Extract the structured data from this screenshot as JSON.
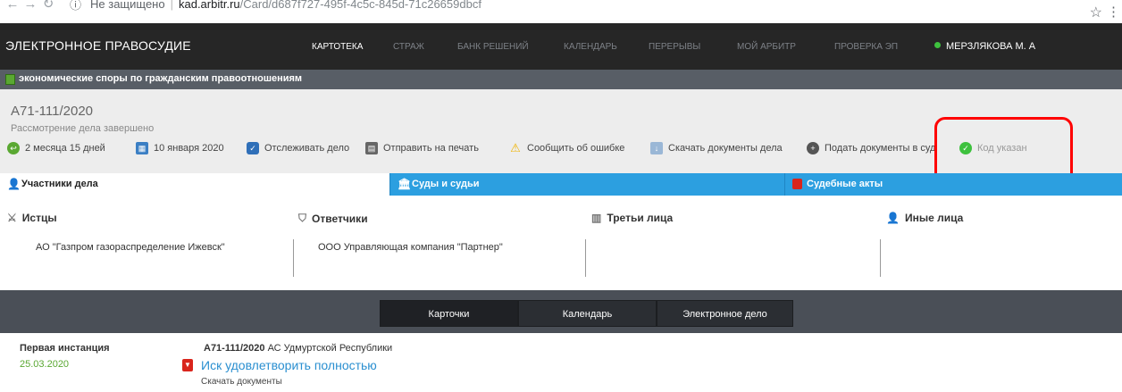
{
  "browser": {
    "security": "Не защищено",
    "host": "kad.arbitr.ru",
    "path": "/Card/d687f727-495f-4c5c-845d-71c26659dbcf"
  },
  "nav": {
    "brand": "ЭЛЕКТРОННОЕ ПРАВОСУДИЕ",
    "items": [
      "КАРТОТЕКА",
      "СТРАЖ",
      "БАНК РЕШЕНИЙ",
      "КАЛЕНДАРЬ",
      "ПЕРЕРЫВЫ",
      "МОЙ АРБИТР",
      "ПРОВЕРКА ЭП"
    ],
    "active": "КАРТОТЕКА",
    "user": "МЕРЗЛЯКОВА М. А"
  },
  "category": "экономические споры по гражданским правоотношениям",
  "case": {
    "number": "А71-111/2020",
    "status": "Рассмотрение дела завершено",
    "actions": [
      {
        "label": "2 месяца 15 дней",
        "icon": "clock-back-icon"
      },
      {
        "label": "10 января 2020",
        "icon": "calendar-icon"
      },
      {
        "label": "Отслеживать дело",
        "icon": "shield-icon"
      },
      {
        "label": "Отправить на печать",
        "icon": "printer-icon"
      },
      {
        "label": "Сообщить об ошибке",
        "icon": "warning-icon"
      },
      {
        "label": "Скачать документы дела",
        "icon": "download-icon"
      },
      {
        "label": "Подать документы в суд",
        "icon": "plus-circle-icon"
      },
      {
        "label": "Код указан",
        "icon": "check-circle-icon"
      }
    ]
  },
  "tabs": {
    "participants": "Участники дела",
    "courts": "Суды и судьи",
    "acts": "Судебные акты"
  },
  "parties": {
    "plaintiffs_h": "Истцы",
    "defendants_h": "Ответчики",
    "third_h": "Третьи лица",
    "others_h": "Иные лица",
    "plaintiff": "АО \"Газпром газораспределение Ижевск\"",
    "defendant": "ООО Управляющая компания \"Партнер\""
  },
  "views": {
    "cards": "Карточки",
    "calendar": "Календарь",
    "ecase": "Электронное дело"
  },
  "instance": {
    "title": "Первая инстанция",
    "date": "25.03.2020",
    "case_num": "А71-111/2020",
    "court": "АС Удмуртской Республики",
    "decision": "Иск удовлетворить полностью",
    "download": "Скачать документы"
  },
  "colors": {
    "topnav": "#262626",
    "tab_blue": "#2c9fe0",
    "link": "#2a8fd0",
    "green": "#5aa832",
    "highlight": "#ff0000"
  }
}
